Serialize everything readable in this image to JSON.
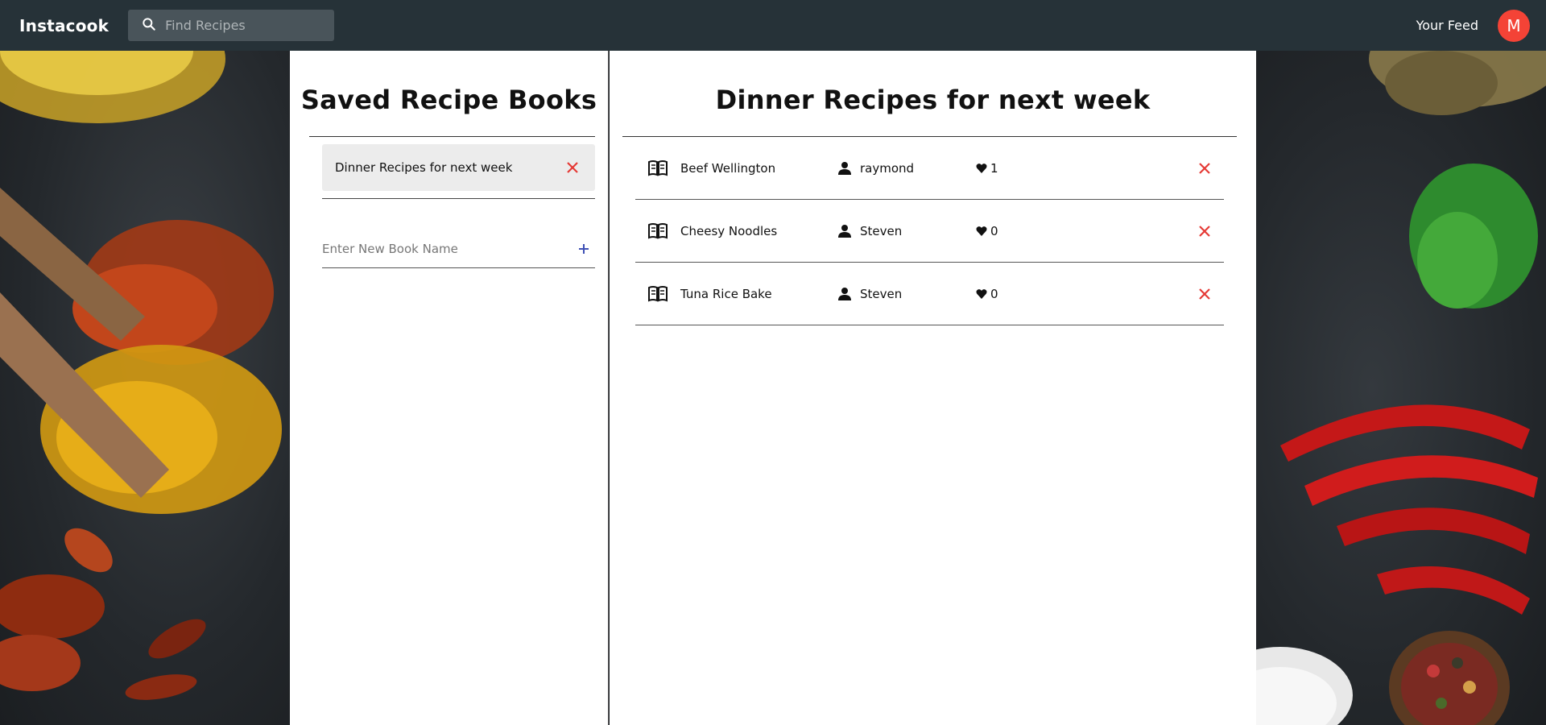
{
  "app": {
    "title": "Instacook"
  },
  "search": {
    "placeholder": "Find Recipes"
  },
  "header": {
    "feed_label": "Your Feed",
    "avatar_initial": "M"
  },
  "saved_books": {
    "title": "Saved Recipe Books",
    "items": [
      {
        "label": "Dinner Recipes for next week"
      }
    ],
    "new_book_placeholder": "Enter New Book Name"
  },
  "book_detail": {
    "title": "Dinner Recipes for next week",
    "recipes": [
      {
        "name": "Beef Wellington",
        "author": "raymond",
        "likes": "1"
      },
      {
        "name": "Cheesy Noodles",
        "author": "Steven",
        "likes": "0"
      },
      {
        "name": "Tuna Rice Bake",
        "author": "Steven",
        "likes": "0"
      }
    ]
  },
  "colors": {
    "topbar": "#263238",
    "accent_red": "#e53935",
    "avatar": "#f44336",
    "plus": "#3f51b5"
  },
  "icons": {
    "search": "search-icon",
    "close": "close-icon",
    "add": "plus-icon",
    "book": "book-icon",
    "person": "person-icon",
    "heart": "heart-icon"
  }
}
